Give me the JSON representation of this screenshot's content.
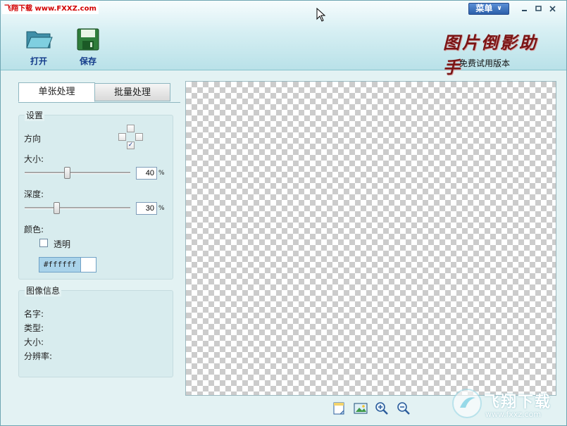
{
  "header": {
    "watermark_text": "飞翔下载 www.FXXZ.com",
    "menu_label": "菜单",
    "window_controls": [
      "minimize",
      "maximize",
      "close"
    ],
    "toolbar": [
      {
        "label": "打开",
        "icon": "open-folder-icon"
      },
      {
        "label": "保存",
        "icon": "save-disk-icon"
      }
    ],
    "logo_text": "图片倒影助手",
    "edition": "免费试用版本"
  },
  "tabs": [
    {
      "label": "单张处理",
      "active": true
    },
    {
      "label": "批量处理",
      "active": false
    }
  ],
  "settings": {
    "title": "设置",
    "direction_label": "方向",
    "direction_selected": "down",
    "size_label": "大小:",
    "size_value": "40",
    "size_percent": 40,
    "depth_label": "深度:",
    "depth_value": "30",
    "depth_percent": 30,
    "percent_sign": "%",
    "color_label": "颜色:",
    "transparent_label": "透明",
    "transparent_checked": false,
    "color_code": "#ffffff",
    "color_value": "#ffffff"
  },
  "image_info": {
    "title": "图像信息",
    "name_label": "名字:",
    "type_label": "类型:",
    "size_label": "大小:",
    "resolution_label": "分辨率:"
  },
  "bottom_tools": [
    "new-page-icon",
    "fit-image-icon",
    "zoom-in-icon",
    "zoom-out-icon"
  ],
  "watermark_bottom": {
    "brand": "飞翔下载",
    "url": "www.fxxz.com"
  },
  "colors": {
    "accent": "#2c5fa9",
    "logo": "#7a1515",
    "watermark": "#d10000"
  }
}
